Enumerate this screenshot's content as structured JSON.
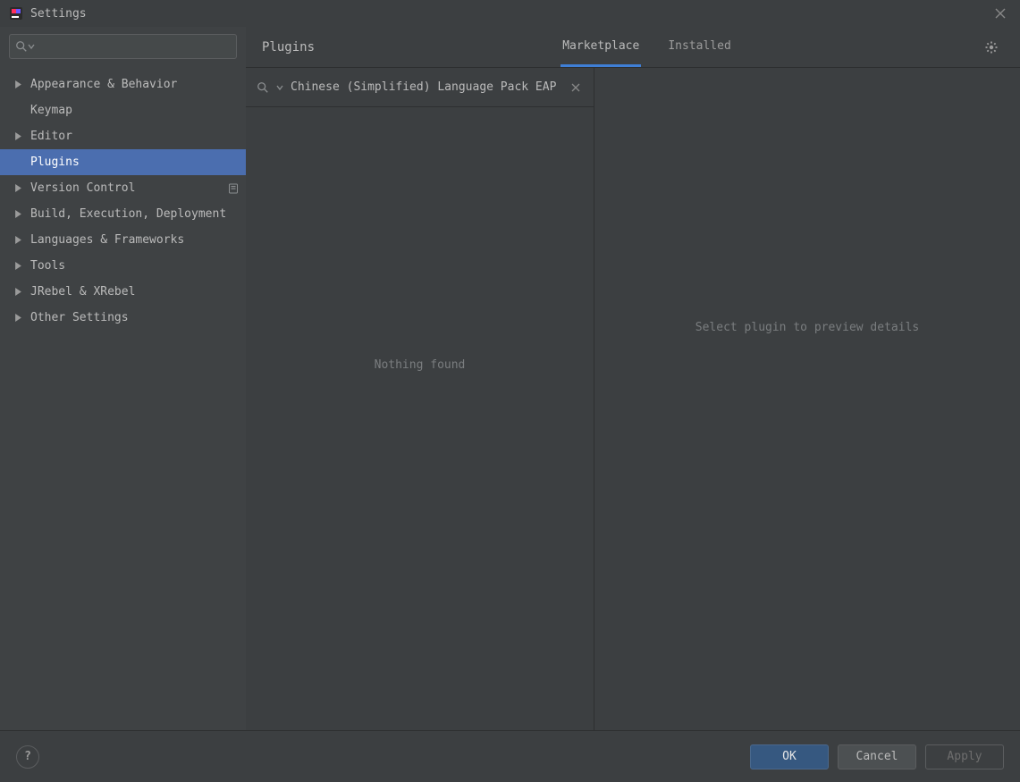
{
  "window": {
    "title": "Settings"
  },
  "sidebar": {
    "search_value": "",
    "items": [
      {
        "label": "Appearance & Behavior",
        "expandable": true
      },
      {
        "label": "Keymap",
        "expandable": false
      },
      {
        "label": "Editor",
        "expandable": true
      },
      {
        "label": "Plugins",
        "expandable": false,
        "active": true
      },
      {
        "label": "Version Control",
        "expandable": true,
        "project_scope": true
      },
      {
        "label": "Build, Execution, Deployment",
        "expandable": true
      },
      {
        "label": "Languages & Frameworks",
        "expandable": true
      },
      {
        "label": "Tools",
        "expandable": true
      },
      {
        "label": "JRebel & XRebel",
        "expandable": true
      },
      {
        "label": "Other Settings",
        "expandable": true
      }
    ]
  },
  "content": {
    "title": "Plugins",
    "tabs": {
      "marketplace": "Marketplace",
      "installed": "Installed",
      "active": "marketplace"
    },
    "plugin_search_value": "Chinese (Simplified) Language Pack EAP",
    "results_empty_text": "Nothing found",
    "preview_placeholder": "Select plugin to preview details"
  },
  "footer": {
    "ok": "OK",
    "cancel": "Cancel",
    "apply": "Apply"
  }
}
